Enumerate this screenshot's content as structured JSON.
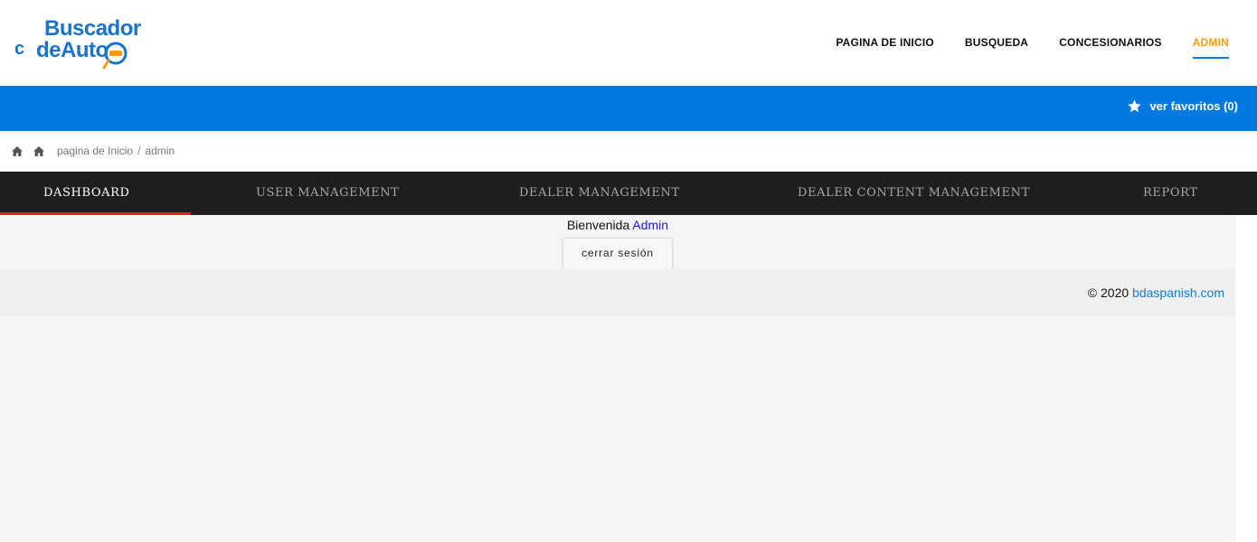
{
  "logo": {
    "prefix": "c",
    "line1": "Buscador",
    "line2": "deAuto"
  },
  "topnav": [
    {
      "label": "PAGINA DE INICIO",
      "active": false
    },
    {
      "label": "BUSQUEDA",
      "active": false
    },
    {
      "label": "CONCESIONARIOS",
      "active": false
    },
    {
      "label": "ADMIN",
      "active": true
    }
  ],
  "favorites": {
    "label": "ver favoritos (0)",
    "icon": "star-icon"
  },
  "breadcrumb": {
    "home": "pagina de Inicio",
    "separator": "/",
    "current": "admin"
  },
  "tabs": [
    {
      "label": "DASHBOARD",
      "active": true
    },
    {
      "label": "USER MANAGEMENT",
      "active": false
    },
    {
      "label": "DEALER MANAGEMENT",
      "active": false
    },
    {
      "label": "DEALER CONTENT MANAGEMENT",
      "active": false
    },
    {
      "label": "REPORT",
      "active": false
    }
  ],
  "welcome": {
    "greeting": "Bienvenida",
    "name": "Admin",
    "logout_label": "cerrar sesión"
  },
  "footer": {
    "copyright": "© 2020",
    "site": "bdaspanish.com"
  },
  "colors": {
    "primary_blue": "#0079e0",
    "accent_orange": "#f39c12",
    "tab_bar": "#1e1e1e",
    "tab_active_underline": "#d9261c"
  }
}
